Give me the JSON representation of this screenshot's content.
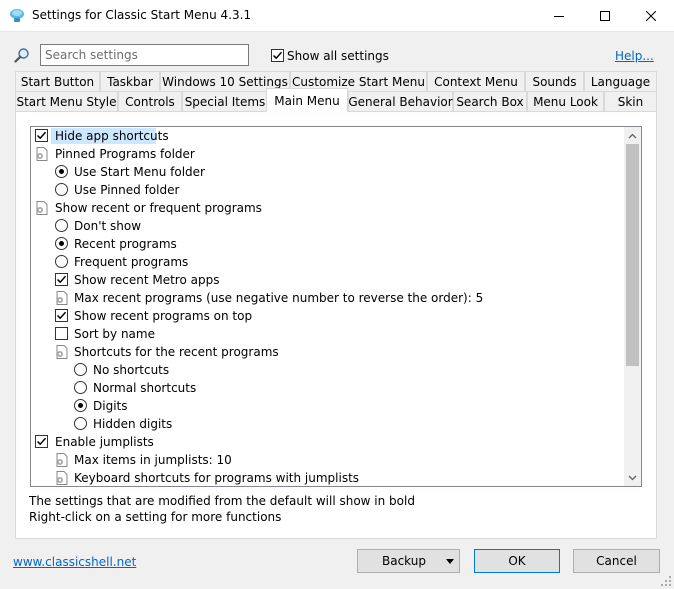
{
  "window": {
    "title": "Settings for Classic Start Menu 4.3.1",
    "controls": {
      "minimize": "minimize",
      "maximize": "maximize",
      "close": "close"
    }
  },
  "toolbar": {
    "search_placeholder": "Search settings",
    "search_value": "",
    "show_all_label": "Show all settings",
    "show_all_checked": true,
    "help_label": "Help..."
  },
  "tabs": {
    "row1": [
      "Start Button",
      "Taskbar",
      "Windows 10 Settings",
      "Customize Start Menu",
      "Context Menu",
      "Sounds",
      "Language"
    ],
    "row2": [
      "Start Menu Style",
      "Controls",
      "Special Items",
      "Main Menu",
      "General Behavior",
      "Search Box",
      "Menu Look",
      "Skin"
    ],
    "active": "Main Menu"
  },
  "settings": [
    {
      "label": "Hide app shortcuts",
      "type": "checkbox",
      "checked": true,
      "selected": true
    },
    {
      "label": "Pinned Programs folder",
      "type": "group"
    },
    {
      "label": "Use Start Menu folder",
      "type": "radio",
      "checked": true
    },
    {
      "label": "Use Pinned folder",
      "type": "radio",
      "checked": false
    },
    {
      "label": "Show recent or frequent programs",
      "type": "group"
    },
    {
      "label": "Don't show",
      "type": "radio",
      "checked": false
    },
    {
      "label": "Recent programs",
      "type": "radio",
      "checked": true
    },
    {
      "label": "Frequent programs",
      "type": "radio",
      "checked": false
    },
    {
      "label": "Show recent Metro apps",
      "type": "checkbox",
      "checked": true
    },
    {
      "label": "Max recent programs (use negative number to reverse the order): 5",
      "type": "value"
    },
    {
      "label": "Show recent programs on top",
      "type": "checkbox",
      "checked": true
    },
    {
      "label": "Sort by name",
      "type": "checkbox",
      "checked": false
    },
    {
      "label": "Shortcuts for the recent programs",
      "type": "group"
    },
    {
      "label": "No shortcuts",
      "type": "radio",
      "checked": false
    },
    {
      "label": "Normal shortcuts",
      "type": "radio",
      "checked": false
    },
    {
      "label": "Digits",
      "type": "radio",
      "checked": true
    },
    {
      "label": "Hidden digits",
      "type": "radio",
      "checked": false
    },
    {
      "label": "Enable jumplists",
      "type": "checkbox",
      "checked": true
    },
    {
      "label": "Max items in jumplists: 10",
      "type": "value"
    },
    {
      "label": "Keyboard shortcuts for programs with jumplists",
      "type": "value"
    }
  ],
  "hints": {
    "line1": "The settings that are modified from the default will show in bold",
    "line2": "Right-click on a setting for more functions"
  },
  "footer": {
    "website": "www.classicshell.net",
    "backup_label": "Backup",
    "ok_label": "OK",
    "cancel_label": "Cancel"
  },
  "icons": {
    "app": "classic-shell-icon",
    "search": "magnifier-icon",
    "setting": "gear-document-icon"
  },
  "colors": {
    "link": "#0066cc",
    "selection": "#cce8ff",
    "default_button_border": "#0078d7"
  }
}
